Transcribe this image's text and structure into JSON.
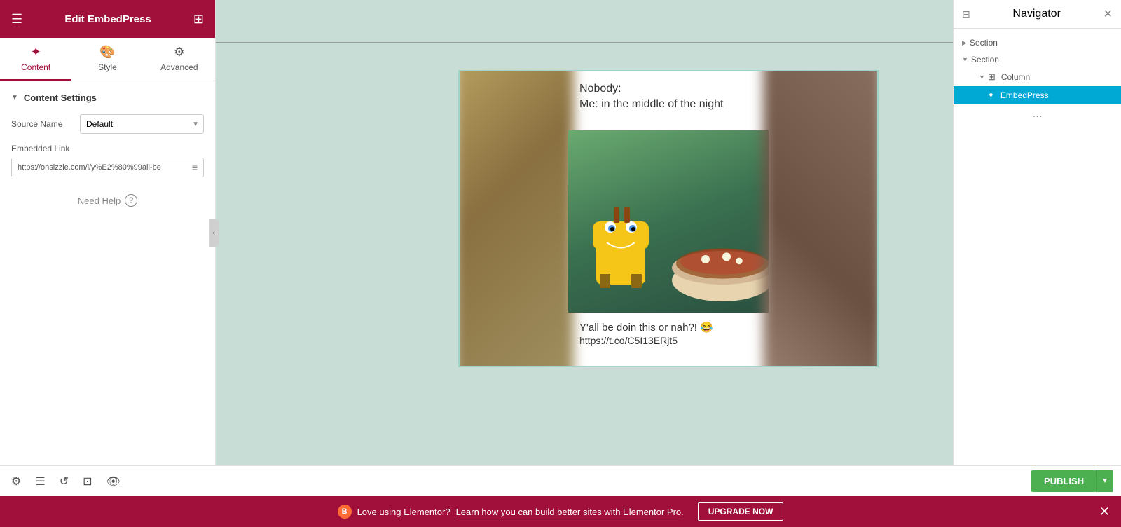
{
  "header": {
    "title": "Edit EmbedPress",
    "menu_icon": "☰",
    "grid_icon": "⊞"
  },
  "tabs": [
    {
      "id": "content",
      "label": "Content",
      "icon": "✦",
      "active": true
    },
    {
      "id": "style",
      "label": "Style",
      "icon": "🎨",
      "active": false
    },
    {
      "id": "advanced",
      "label": "Advanced",
      "icon": "⚙",
      "active": false
    }
  ],
  "content_settings": {
    "section_label": "Content Settings",
    "source_name_label": "Source Name",
    "source_name_default": "Default",
    "source_name_options": [
      "Default"
    ],
    "embedded_link_label": "Embedded Link",
    "embedded_link_value": "https://onsizzle.com/i/y%E2%80%99all-be",
    "embedded_link_placeholder": "https://onsizzle.com/i/y%E2%80%99all-be"
  },
  "need_help_label": "Need Help",
  "embed": {
    "nobody_text": "Nobody:",
    "me_text": "Me: in the middle of the night",
    "caption": "Y'all be doin this or nah?! 😂",
    "link": "https://t.co/C5I13ERjt5"
  },
  "navigator": {
    "title": "Navigator",
    "items": [
      {
        "label": "Section",
        "indent": 0,
        "expanded": false,
        "has_arrow": true,
        "arrow_right": true
      },
      {
        "label": "Section",
        "indent": 0,
        "expanded": true,
        "has_arrow": true,
        "arrow_down": true
      },
      {
        "label": "Column",
        "indent": 2,
        "has_icon": true
      },
      {
        "label": "EmbedPress",
        "indent": 3,
        "active": true,
        "has_embed_icon": true
      }
    ],
    "dots": "···"
  },
  "bottom_bar": {
    "publish_label": "PUBLISH",
    "icons": [
      "⚙",
      "☰",
      "↺",
      "⊡",
      "👁"
    ]
  },
  "promo_bar": {
    "badge": "B",
    "text": "Love using Elementor?",
    "link_text": "Learn how you can build better sites with Elementor Pro.",
    "upgrade_label": "UPGRADE NOW"
  }
}
